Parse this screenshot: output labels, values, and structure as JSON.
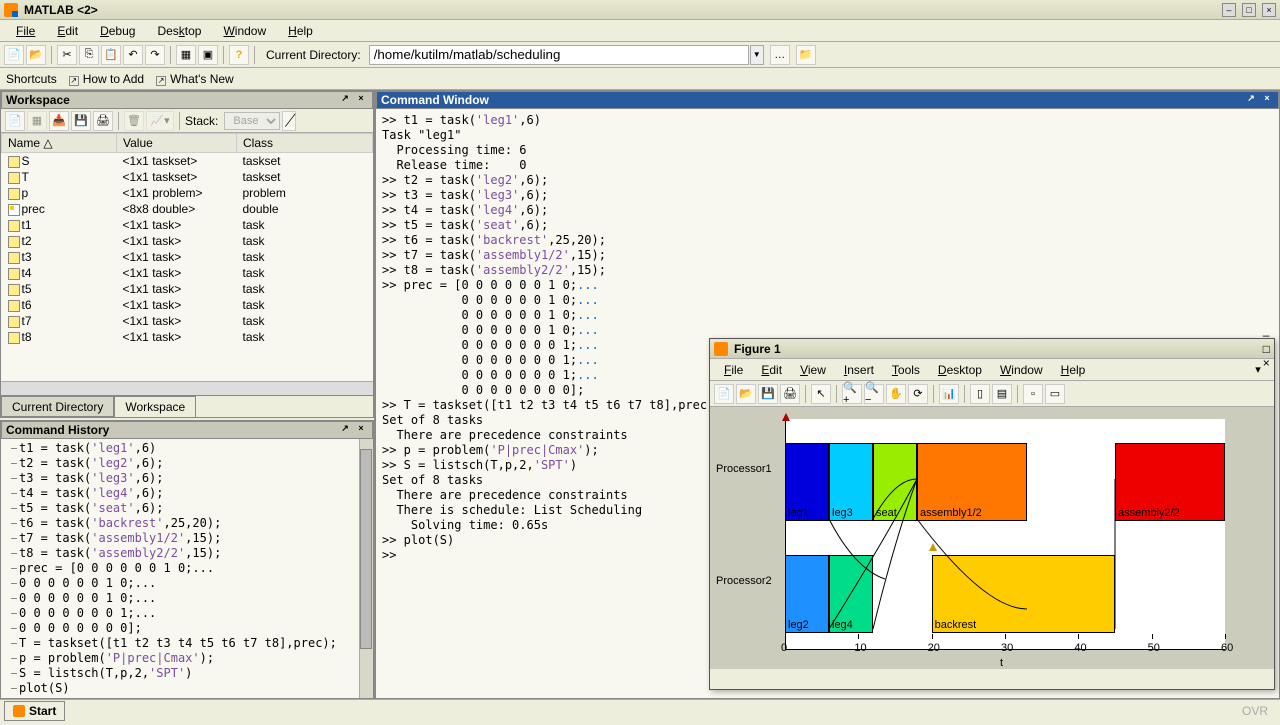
{
  "title": "MATLAB <2>",
  "menubar": [
    "File",
    "Edit",
    "Debug",
    "Desktop",
    "Window",
    "Help"
  ],
  "toolbar": {
    "currentdir_label": "Current Directory:",
    "currentdir_value": "/home/kutilm/matlab/scheduling"
  },
  "shortcuts": {
    "label": "Shortcuts",
    "howtoadd": "How to Add",
    "whatsnew": "What's New"
  },
  "workspace": {
    "title": "Workspace",
    "stack_label": "Stack:",
    "stack_value": "Base",
    "cols": [
      "Name △",
      "Value",
      "Class"
    ],
    "rows": [
      {
        "name": "S",
        "value": "<1x1 taskset>",
        "cls": "taskset",
        "icon": "struct"
      },
      {
        "name": "T",
        "value": "<1x1 taskset>",
        "cls": "taskset",
        "icon": "struct"
      },
      {
        "name": "p",
        "value": "<1x1 problem>",
        "cls": "problem",
        "icon": "struct"
      },
      {
        "name": "prec",
        "value": "<8x8 double>",
        "cls": "double",
        "icon": "dbl"
      },
      {
        "name": "t1",
        "value": "<1x1 task>",
        "cls": "task",
        "icon": "struct"
      },
      {
        "name": "t2",
        "value": "<1x1 task>",
        "cls": "task",
        "icon": "struct"
      },
      {
        "name": "t3",
        "value": "<1x1 task>",
        "cls": "task",
        "icon": "struct"
      },
      {
        "name": "t4",
        "value": "<1x1 task>",
        "cls": "task",
        "icon": "struct"
      },
      {
        "name": "t5",
        "value": "<1x1 task>",
        "cls": "task",
        "icon": "struct"
      },
      {
        "name": "t6",
        "value": "<1x1 task>",
        "cls": "task",
        "icon": "struct"
      },
      {
        "name": "t7",
        "value": "<1x1 task>",
        "cls": "task",
        "icon": "struct"
      },
      {
        "name": "t8",
        "value": "<1x1 task>",
        "cls": "task",
        "icon": "struct"
      }
    ],
    "tabs": [
      "Current Directory",
      "Workspace"
    ],
    "active_tab": 1
  },
  "cmdhist": {
    "title": "Command History",
    "lines": [
      {
        "plain": "t1 = task(",
        "str": "'leg1'",
        "rest": ",6)"
      },
      {
        "plain": "t2 = task(",
        "str": "'leg2'",
        "rest": ",6);"
      },
      {
        "plain": "t3 = task(",
        "str": "'leg3'",
        "rest": ",6);"
      },
      {
        "plain": "t4 = task(",
        "str": "'leg4'",
        "rest": ",6);"
      },
      {
        "plain": "t5 = task(",
        "str": "'seat'",
        "rest": ",6);"
      },
      {
        "plain": "t6 = task(",
        "str": "'backrest'",
        "rest": ",25,20);"
      },
      {
        "plain": "t7 = task(",
        "str": "'assembly1/2'",
        "rest": ",15);"
      },
      {
        "plain": "t8 = task(",
        "str": "'assembly2/2'",
        "rest": ",15);"
      },
      {
        "plain": "prec = [0 0 0 0 0 0 1 0;",
        "cont": "..."
      },
      {
        "plain": "0 0 0 0 0 0 1 0;",
        "cont": "..."
      },
      {
        "plain": "0 0 0 0 0 0 1 0;",
        "cont": "..."
      },
      {
        "plain": "0 0 0 0 0 0 0 1;",
        "cont": "..."
      },
      {
        "plain": "0 0 0 0 0 0 0 0];"
      },
      {
        "plain": "T = taskset([t1 t2 t3 t4 t5 t6 t7 t8],prec);"
      },
      {
        "plain": "p = problem(",
        "str": "'P|prec|Cmax'",
        "rest": ");"
      },
      {
        "plain": "S = listsch(T,p,2,",
        "str": "'SPT'",
        "rest": ")"
      },
      {
        "plain": "plot(S)"
      }
    ]
  },
  "cmdwin": {
    "title": "Command Window",
    "lines": [
      {
        "pre": ">> t1 = task(",
        "str": "'leg1'",
        "post": ",6)"
      },
      {
        "pre": "Task \"leg1\""
      },
      {
        "pre": "  Processing time: 6"
      },
      {
        "pre": "  Release time:    0"
      },
      {
        "pre": ">> t2 = task(",
        "str": "'leg2'",
        "post": ",6);"
      },
      {
        "pre": ">> t3 = task(",
        "str": "'leg3'",
        "post": ",6);"
      },
      {
        "pre": ">> t4 = task(",
        "str": "'leg4'",
        "post": ",6);"
      },
      {
        "pre": ">> t5 = task(",
        "str": "'seat'",
        "post": ",6);"
      },
      {
        "pre": ">> t6 = task(",
        "str": "'backrest'",
        "post": ",25,20);"
      },
      {
        "pre": ">> t7 = task(",
        "str": "'assembly1/2'",
        "post": ",15);"
      },
      {
        "pre": ">> t8 = task(",
        "str": "'assembly2/2'",
        "post": ",15);"
      },
      {
        "pre": ">> prec = [0 0 0 0 0 0 1 0;",
        "cont": "..."
      },
      {
        "pre": "           0 0 0 0 0 0 1 0;",
        "cont": "..."
      },
      {
        "pre": "           0 0 0 0 0 0 1 0;",
        "cont": "..."
      },
      {
        "pre": "           0 0 0 0 0 0 1 0;",
        "cont": "..."
      },
      {
        "pre": "           0 0 0 0 0 0 0 1;",
        "cont": "..."
      },
      {
        "pre": "           0 0 0 0 0 0 0 1;",
        "cont": "..."
      },
      {
        "pre": "           0 0 0 0 0 0 0 1;",
        "cont": "..."
      },
      {
        "pre": "           0 0 0 0 0 0 0 0];"
      },
      {
        "pre": ">> T = taskset([t1 t2 t3 t4 t5 t6 t7 t8],prec);"
      },
      {
        "pre": "Set of 8 tasks"
      },
      {
        "pre": "  There are precedence constraints"
      },
      {
        "pre": ">> p = problem(",
        "str": "'P|prec|Cmax'",
        "post": ");"
      },
      {
        "pre": ">> S = listsch(T,p,2,",
        "str": "'SPT'",
        "post": ")"
      },
      {
        "pre": "Set of 8 tasks"
      },
      {
        "pre": "  There are precedence constraints"
      },
      {
        "pre": "  There is schedule: List Scheduling"
      },
      {
        "pre": "    Solving time: 0.65s"
      },
      {
        "pre": ">> plot(S)"
      },
      {
        "pre": ">> "
      }
    ]
  },
  "figure": {
    "title": "Figure 1",
    "menubar": [
      "File",
      "Edit",
      "View",
      "Insert",
      "Tools",
      "Desktop",
      "Window",
      "Help"
    ],
    "ylabels": [
      "Processor1",
      "Processor2"
    ],
    "xticks": [
      "0",
      "10",
      "20",
      "30",
      "40",
      "50",
      "60"
    ],
    "xlabel": "t"
  },
  "chart_data": {
    "type": "bar",
    "xlabel": "t",
    "xlim": [
      0,
      60
    ],
    "processors": [
      "Processor1",
      "Processor2"
    ],
    "tasks": [
      {
        "name": "leg1",
        "processor": 1,
        "start": 0,
        "end": 6,
        "color": "#0000dd"
      },
      {
        "name": "leg3",
        "processor": 1,
        "start": 6,
        "end": 12,
        "color": "#00ccff"
      },
      {
        "name": "seat",
        "processor": 1,
        "start": 12,
        "end": 18,
        "color": "#99ee00"
      },
      {
        "name": "assembly1/2",
        "processor": 1,
        "start": 18,
        "end": 33,
        "color": "#ff7700"
      },
      {
        "name": "assembly2/2",
        "processor": 1,
        "start": 45,
        "end": 60,
        "color": "#ee0000"
      },
      {
        "name": "leg2",
        "processor": 2,
        "start": 0,
        "end": 6,
        "color": "#1e90ff"
      },
      {
        "name": "leg4",
        "processor": 2,
        "start": 6,
        "end": 12,
        "color": "#00dd88"
      },
      {
        "name": "backrest",
        "processor": 2,
        "start": 20,
        "end": 45,
        "color": "#ffcc00"
      }
    ]
  },
  "status": {
    "start": "Start",
    "ovr": "OVR"
  }
}
